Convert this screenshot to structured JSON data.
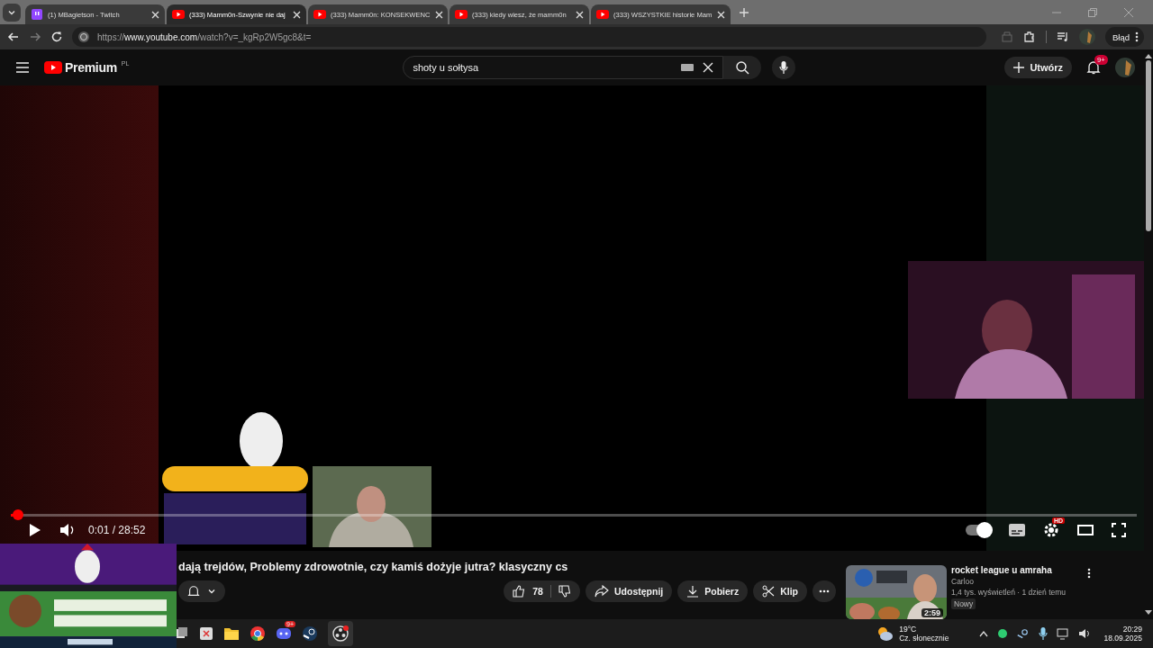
{
  "browser": {
    "tabs": [
      {
        "label": "(1) MBagietson - Twitch",
        "kind": "twitch",
        "selected": false
      },
      {
        "label": "(333) Mamm0n-Szwynie nie daj",
        "kind": "youtube",
        "selected": true
      },
      {
        "label": "(333) Mamm0n: KONSEKWENC",
        "kind": "youtube",
        "selected": false
      },
      {
        "label": "(333) kiedy wiesz, że mamm0n",
        "kind": "youtube",
        "selected": false
      },
      {
        "label": "(333) WSZYSTKIE historie Mam",
        "kind": "youtube",
        "selected": false
      }
    ],
    "url": {
      "scheme": "https://",
      "host": "www.youtube.com",
      "path": "/watch?v=_kgRp2W5gc8&t="
    },
    "profile": "Błąd"
  },
  "header": {
    "logo": "Premium",
    "region": "PL",
    "search": {
      "value": "shoty u sołtysa"
    },
    "create": "Utwórz",
    "notifications": "9+"
  },
  "player": {
    "progress": {
      "level": 0.006
    },
    "time": "0:01 / 28:52",
    "autoplay": true,
    "quality": "HD"
  },
  "video": {
    "title": "dają trejdów, Problemy zdrowotnie, czy kamiś dożyje jutra? klasyczny cs",
    "likes": "78",
    "actions": [
      "Udostępnij",
      "Pobierz",
      "Klip"
    ]
  },
  "recommendation": {
    "title": "rocket league u amraha",
    "channel": "Carloo",
    "meta": "1,4 tys. wyświetleń · 1 dzień temu",
    "badge": "Nowy",
    "duration": "2:59"
  },
  "taskbar": {
    "chat_badge": "9+",
    "weather": {
      "temp": "19°C",
      "desc": "Cz. słonecznie"
    },
    "time": "20:29",
    "date": "18.09.2025"
  }
}
